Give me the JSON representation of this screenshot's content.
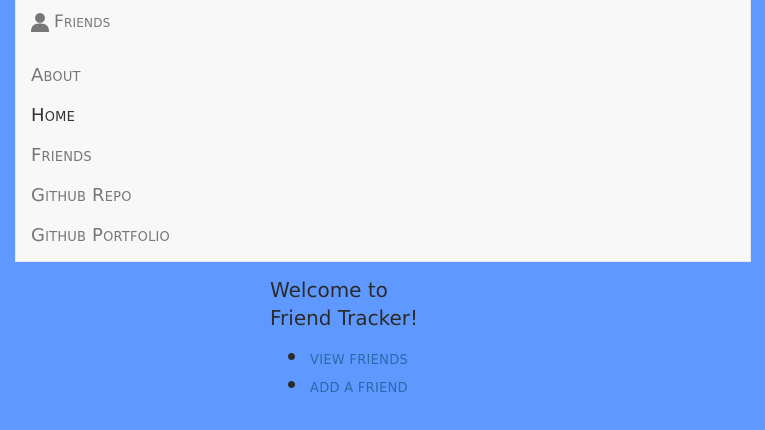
{
  "navbar": {
    "brand_label": "Friends",
    "brand_icon": "user-icon",
    "items": [
      {
        "label": "About",
        "active": false
      },
      {
        "label": "Home",
        "active": true
      },
      {
        "label": "Friends",
        "active": false
      },
      {
        "label": "Github Repo",
        "active": false
      },
      {
        "label": "Github Portfolio",
        "active": false
      }
    ]
  },
  "main": {
    "title": "Welcome to Friend Tracker!",
    "links": [
      {
        "label": "View Friends"
      },
      {
        "label": "Add a Friend"
      }
    ]
  },
  "colors": {
    "page_background": "#5f99ff",
    "navbar_background": "#f8f8f8",
    "nav_text": "#777777",
    "nav_active_text": "#333333",
    "link_text": "#2a6aa8"
  }
}
